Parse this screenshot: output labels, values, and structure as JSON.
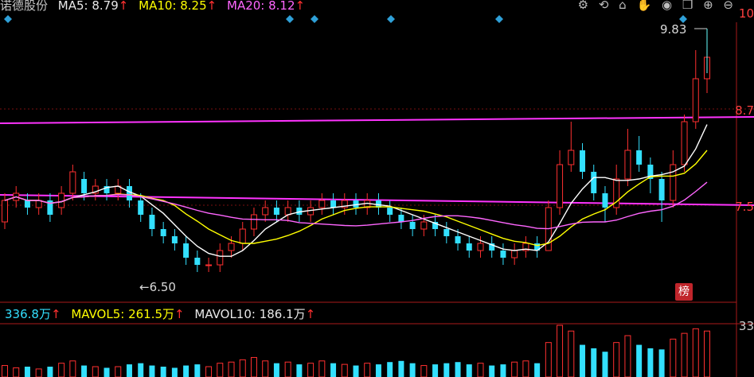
{
  "header": {
    "stock_name": "诺德股份",
    "ma5_label": "MA5: 8.79",
    "ma10_label": "MA10: 8.25",
    "ma20_label": "MA20: 8.12",
    "arrow": "↑"
  },
  "toolbar": {
    "icons": [
      "gear-icon",
      "restore-icon",
      "basket-icon",
      "hand-icon",
      "eye-icon",
      "copy-icon",
      "plus-icon",
      "minus-icon"
    ]
  },
  "price_axis": {
    "top_label": "10",
    "mid_label": "8.7",
    "low_label": "7.5"
  },
  "annotations": {
    "high_label": "9.83",
    "low_label": "6.50",
    "bang_label": "榜"
  },
  "volume_header": {
    "current": "336.8万",
    "mavol5": "MAVOL5: 261.5万",
    "mavol10": "MAVOL10: 186.1万",
    "arrow": "↑"
  },
  "volume_axis": {
    "top_label": "33"
  },
  "colors": {
    "up": "#ff3030",
    "down": "#33e0ff",
    "ma5": "#ffffff",
    "ma10": "#ffff00",
    "ma20": "#ff66ff",
    "hline": "#ff33ff"
  },
  "chart_data": {
    "type": "candlestick",
    "ylim": [
      6.3,
      10.0
    ],
    "high_marker": 9.83,
    "low_marker": 6.5,
    "candles": [
      [
        7.2,
        7.5,
        7.6,
        7.1
      ],
      [
        7.5,
        7.6,
        7.7,
        7.4
      ],
      [
        7.5,
        7.4,
        7.6,
        7.3
      ],
      [
        7.4,
        7.5,
        7.6,
        7.3
      ],
      [
        7.5,
        7.3,
        7.6,
        7.2
      ],
      [
        7.4,
        7.6,
        7.7,
        7.3
      ],
      [
        7.6,
        7.9,
        8.0,
        7.5
      ],
      [
        7.8,
        7.6,
        7.9,
        7.5
      ],
      [
        7.6,
        7.7,
        7.8,
        7.5
      ],
      [
        7.7,
        7.6,
        7.8,
        7.5
      ],
      [
        7.6,
        7.7,
        7.8,
        7.5
      ],
      [
        7.7,
        7.5,
        7.8,
        7.4
      ],
      [
        7.5,
        7.3,
        7.6,
        7.2
      ],
      [
        7.3,
        7.1,
        7.4,
        7.0
      ],
      [
        7.1,
        7.0,
        7.2,
        6.9
      ],
      [
        7.0,
        6.9,
        7.1,
        6.8
      ],
      [
        6.9,
        6.7,
        7.0,
        6.6
      ],
      [
        6.7,
        6.6,
        6.8,
        6.5
      ],
      [
        6.6,
        6.6,
        6.7,
        6.5
      ],
      [
        6.6,
        6.8,
        6.9,
        6.5
      ],
      [
        6.8,
        6.9,
        7.0,
        6.7
      ],
      [
        6.9,
        7.1,
        7.2,
        6.8
      ],
      [
        7.1,
        7.3,
        7.4,
        7.0
      ],
      [
        7.3,
        7.4,
        7.5,
        7.2
      ],
      [
        7.4,
        7.3,
        7.5,
        7.2
      ],
      [
        7.3,
        7.4,
        7.5,
        7.2
      ],
      [
        7.4,
        7.3,
        7.5,
        7.2
      ],
      [
        7.3,
        7.4,
        7.5,
        7.2
      ],
      [
        7.4,
        7.5,
        7.6,
        7.3
      ],
      [
        7.5,
        7.4,
        7.6,
        7.3
      ],
      [
        7.4,
        7.5,
        7.6,
        7.3
      ],
      [
        7.5,
        7.4,
        7.6,
        7.3
      ],
      [
        7.4,
        7.5,
        7.6,
        7.3
      ],
      [
        7.5,
        7.4,
        7.6,
        7.3
      ],
      [
        7.4,
        7.3,
        7.5,
        7.2
      ],
      [
        7.3,
        7.2,
        7.4,
        7.1
      ],
      [
        7.2,
        7.1,
        7.3,
        7.0
      ],
      [
        7.1,
        7.2,
        7.3,
        7.0
      ],
      [
        7.2,
        7.1,
        7.3,
        7.0
      ],
      [
        7.1,
        7.0,
        7.2,
        6.9
      ],
      [
        7.0,
        6.9,
        7.1,
        6.8
      ],
      [
        6.9,
        6.8,
        7.0,
        6.7
      ],
      [
        6.8,
        6.9,
        7.0,
        6.7
      ],
      [
        6.9,
        6.8,
        7.0,
        6.7
      ],
      [
        6.8,
        6.7,
        6.9,
        6.6
      ],
      [
        6.7,
        6.8,
        6.9,
        6.6
      ],
      [
        6.8,
        6.9,
        7.0,
        6.7
      ],
      [
        6.9,
        6.8,
        7.0,
        6.7
      ],
      [
        6.8,
        7.4,
        7.5,
        6.8
      ],
      [
        7.4,
        8.0,
        8.2,
        7.3
      ],
      [
        8.0,
        8.2,
        8.6,
        7.9
      ],
      [
        8.2,
        7.9,
        8.3,
        7.8
      ],
      [
        7.9,
        7.6,
        8.0,
        7.5
      ],
      [
        7.6,
        7.4,
        7.7,
        7.2
      ],
      [
        7.4,
        7.8,
        8.0,
        7.3
      ],
      [
        7.8,
        8.2,
        8.5,
        7.7
      ],
      [
        8.2,
        8.0,
        8.4,
        7.9
      ],
      [
        8.0,
        7.8,
        8.1,
        7.6
      ],
      [
        7.8,
        7.5,
        7.9,
        7.2
      ],
      [
        7.5,
        8.0,
        8.2,
        7.4
      ],
      [
        8.0,
        8.6,
        8.7,
        7.9
      ],
      [
        8.6,
        9.2,
        9.6,
        8.5
      ],
      [
        9.2,
        9.5,
        9.83,
        9.0
      ]
    ],
    "volume": [
      10,
      8,
      9,
      7,
      9,
      12,
      14,
      10,
      9,
      8,
      9,
      11,
      12,
      10,
      9,
      8,
      10,
      11,
      9,
      12,
      13,
      15,
      17,
      14,
      12,
      13,
      11,
      12,
      14,
      12,
      11,
      10,
      12,
      11,
      13,
      14,
      12,
      10,
      11,
      12,
      13,
      11,
      12,
      10,
      11,
      13,
      14,
      12,
      30,
      45,
      40,
      28,
      25,
      22,
      30,
      36,
      28,
      25,
      24,
      33,
      38,
      42,
      40
    ]
  }
}
